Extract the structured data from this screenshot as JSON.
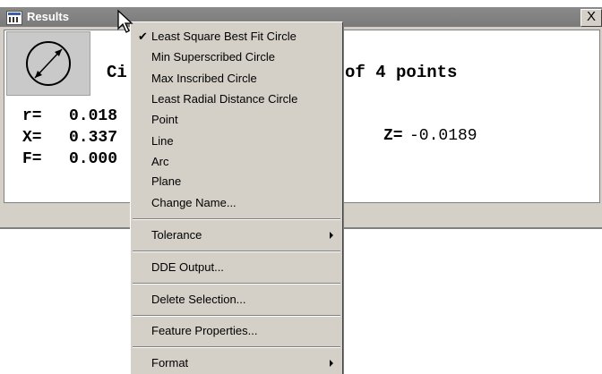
{
  "window": {
    "title": "Results",
    "close_label": "X"
  },
  "feature": {
    "text_left": "Ci",
    "text_right": "of 4 points"
  },
  "results": {
    "r": {
      "label": "r=",
      "value": "0.018"
    },
    "x": {
      "label": "X=",
      "value": "0.337"
    },
    "f": {
      "label": "F=",
      "value": "0.000"
    },
    "z": {
      "label": "Z=",
      "value": "-0.0189"
    }
  },
  "menu": {
    "check_symbol": "✔",
    "items": [
      {
        "label": "Least Square Best Fit Circle",
        "checked": true
      },
      {
        "label": "Min Superscribed Circle"
      },
      {
        "label": "Max Inscribed Circle"
      },
      {
        "label": "Least Radial Distance Circle"
      },
      {
        "label": "Point"
      },
      {
        "label": "Line"
      },
      {
        "label": "Arc"
      },
      {
        "label": "Plane"
      },
      {
        "label": "Change Name..."
      },
      {
        "label": "Tolerance",
        "submenu": true
      },
      {
        "label": "DDE Output..."
      },
      {
        "label": "Delete Selection..."
      },
      {
        "label": "Feature Properties..."
      },
      {
        "label": "Format",
        "submenu": true
      }
    ]
  },
  "colors": {
    "titlebar": "#7f7f7f",
    "menu_bg": "#d4d0c8",
    "content_bg": "#ffffff"
  }
}
